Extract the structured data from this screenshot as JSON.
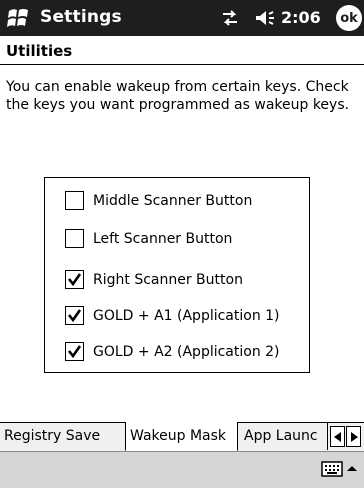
{
  "titlebar": {
    "app_title": "Settings",
    "clock": "2:06",
    "ok_label": "ok"
  },
  "page": {
    "title": "Utilities",
    "description": "You can enable wakeup from certain keys. Check the keys you want programmed as wakeup keys."
  },
  "options": [
    {
      "label": "Middle Scanner Button",
      "checked": false
    },
    {
      "label": "Left Scanner Button",
      "checked": false
    },
    {
      "label": "Right Scanner Button",
      "checked": true
    },
    {
      "label": "GOLD + A1 (Application 1)",
      "checked": true
    },
    {
      "label": "GOLD + A2 (Application 2)",
      "checked": true
    }
  ],
  "tabs": [
    {
      "label": "Registry Save",
      "active": false
    },
    {
      "label": "Wakeup Mask",
      "active": true
    },
    {
      "label": "App Launc",
      "active": false
    }
  ]
}
